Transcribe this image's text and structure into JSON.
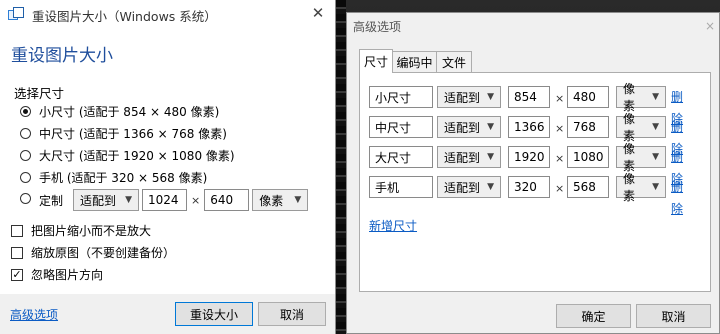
{
  "left": {
    "title": "重设图片大小（Windows 系统）",
    "heading": "重设图片大小",
    "section_label": "选择尺寸",
    "options": [
      {
        "label": "小尺寸 (适配于 854 × 480 像素)",
        "selected": true
      },
      {
        "label": "中尺寸 (适配于 1366 × 768 像素)",
        "selected": false
      },
      {
        "label": "大尺寸 (适配于 1920 × 1080 像素)",
        "selected": false
      },
      {
        "label": "手机 (适配于 320 × 568 像素)",
        "selected": false
      }
    ],
    "custom": {
      "label": "定制",
      "mode": "适配到",
      "width": "1024",
      "times": "×",
      "height": "640",
      "unit": "像素"
    },
    "checks": [
      {
        "label": "把图片缩小而不是放大",
        "checked": false
      },
      {
        "label": "缩放原图（不要创建备份）",
        "checked": false
      },
      {
        "label": "忽略图片方向",
        "checked": true
      }
    ],
    "footer": {
      "advanced_link": "高级选项",
      "resize_button": "重设大小",
      "cancel_button": "取消"
    }
  },
  "right": {
    "title": "高级选项",
    "close_glyph": "×",
    "tabs": [
      "尺寸",
      "编码中",
      "文件"
    ],
    "active_tab": 0,
    "sizes": [
      {
        "name": "小尺寸",
        "mode": "适配到",
        "width": "854",
        "height": "480",
        "unit": "像素",
        "delete": "删除"
      },
      {
        "name": "中尺寸",
        "mode": "适配到",
        "width": "1366",
        "height": "768",
        "unit": "像素",
        "delete": "删除"
      },
      {
        "name": "大尺寸",
        "mode": "适配到",
        "width": "1920",
        "height": "1080",
        "unit": "像素",
        "delete": "删除"
      },
      {
        "name": "手机",
        "mode": "适配到",
        "width": "320",
        "height": "568",
        "unit": "像素",
        "delete": "删除"
      }
    ],
    "times": "×",
    "add_link": "新增尺寸",
    "ok_button": "确定",
    "cancel_button": "取消"
  },
  "colors": {
    "heading": "#1f4e9c",
    "link": "#0b5bc4"
  }
}
